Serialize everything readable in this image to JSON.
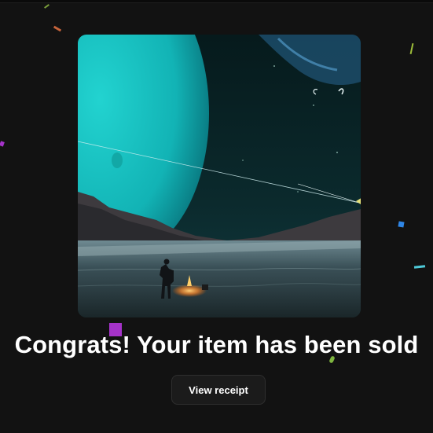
{
  "headline": "Congrats! Your item has been sold",
  "actions": {
    "view_receipt_label": "View receipt"
  },
  "artwork": {
    "subject": "planet-landscape-artwork"
  },
  "colors": {
    "background": "#121212",
    "button_bg": "#1b1b1b",
    "button_border": "#2e2e2e",
    "text": "#ffffff",
    "confetti": [
      "#a533c9",
      "#7a9e3a",
      "#c7643b",
      "#2f86e6",
      "#4ec9d8",
      "#9fbf3a"
    ]
  }
}
